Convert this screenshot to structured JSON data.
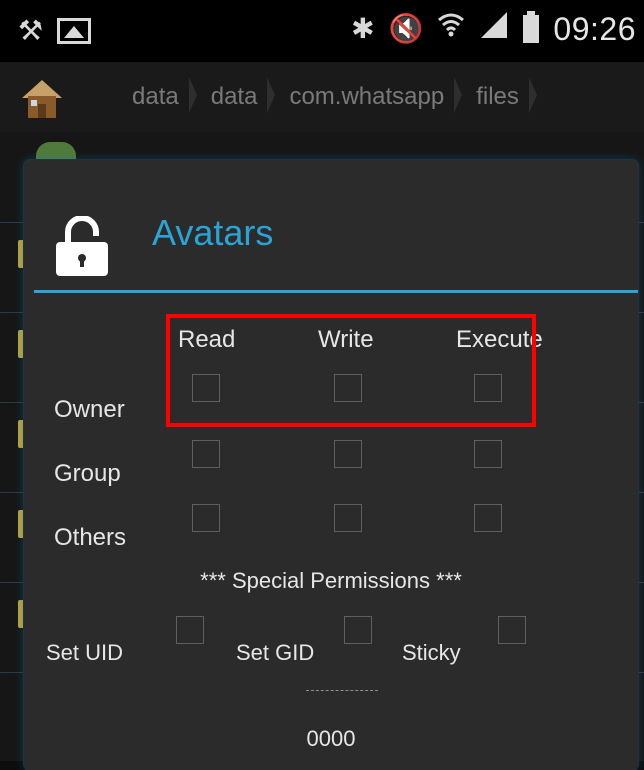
{
  "status_bar": {
    "time": "09:26",
    "icons": [
      "usb-debug-icon",
      "gallery-icon",
      "bluetooth-icon",
      "mute-icon",
      "wifi-icon",
      "signal-icon",
      "battery-icon"
    ]
  },
  "breadcrumb": {
    "items": [
      "data",
      "data",
      "com.whatsapp",
      "files"
    ]
  },
  "dialog": {
    "title": "Avatars",
    "columns": [
      "Read",
      "Write",
      "Execute"
    ],
    "rows": [
      {
        "label": "Owner",
        "read": false,
        "write": false,
        "execute": false
      },
      {
        "label": "Group",
        "read": false,
        "write": false,
        "execute": false
      },
      {
        "label": "Others",
        "read": false,
        "write": false,
        "execute": false
      }
    ],
    "special_header": "*** Special Permissions ***",
    "special": [
      {
        "label": "Set UID",
        "checked": false
      },
      {
        "label": "Set GID",
        "checked": false
      },
      {
        "label": "Sticky",
        "checked": false
      }
    ],
    "separator": "---------",
    "octal_value": "0000"
  },
  "colors": {
    "accent": "#2aa4d6",
    "highlight": "#ff0000",
    "dialog_bg": "#2b2b2b"
  }
}
